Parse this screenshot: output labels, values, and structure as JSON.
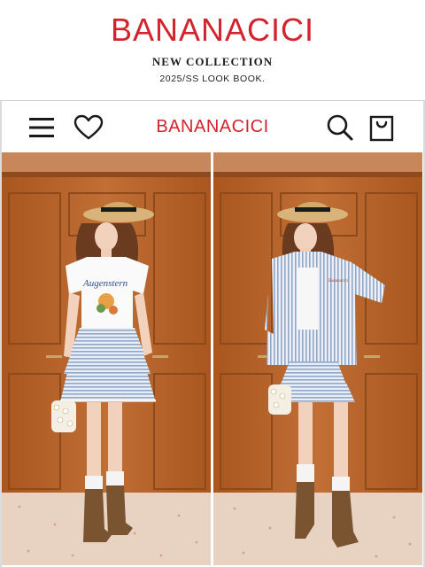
{
  "hero": {
    "brand": "BANANACICI",
    "line1": "NEW COLLECTION",
    "line2": "2025/SS LOOK BOOK."
  },
  "nav": {
    "logo": "BANANACICI",
    "icons": [
      "menu-icon",
      "heart-icon",
      "search-icon",
      "bag-icon"
    ]
  },
  "looks": [
    {
      "tee_print": "Augenstern"
    },
    {
      "pocket_tag": "Bananacici"
    }
  ],
  "colors": {
    "brand_red": "#d3232d",
    "wood": "#b8652e",
    "stripe_blue": "#8fa7c8",
    "boot_brown": "#7a5330"
  }
}
